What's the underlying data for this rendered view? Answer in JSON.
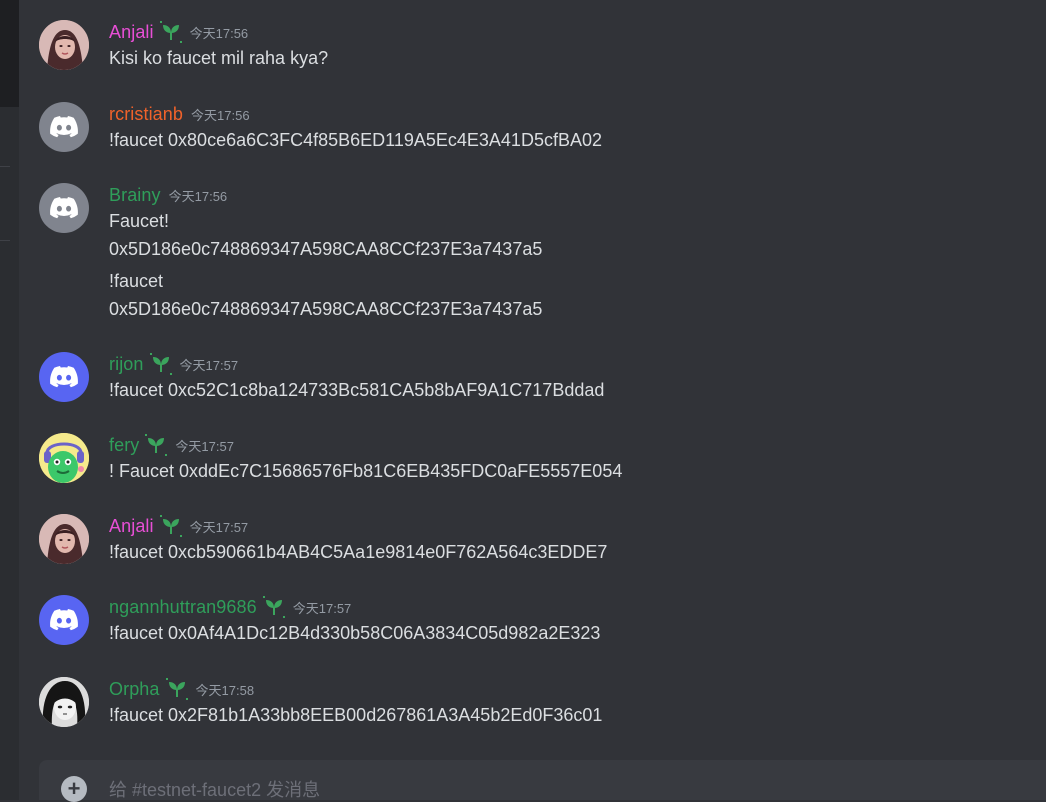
{
  "colors": {
    "bg": "#313338",
    "text": "#dbdee1",
    "timestamp": "#949ba4",
    "pink_name": "#e84fd6",
    "orange_name": "#f0622a",
    "green_name": "#2f9e5a",
    "discord_grey": "#80848e",
    "discord_blurple": "#5865f2",
    "badge_green": "#3ba55d"
  },
  "messages": [
    {
      "username": "Anjali",
      "time": "今天17:56",
      "lines": [
        "Kisi ko faucet mil raha kya?"
      ]
    },
    {
      "username": "rcristianb",
      "time": "今天17:56",
      "lines": [
        "!faucet 0x80ce6a6C3FC4f85B6ED119A5Ec4E3A41D5cfBA02"
      ]
    },
    {
      "username": "Brainy",
      "time": "今天17:56",
      "lines": [
        "Faucet!",
        "0x5D186e0c748869347A598CAA8CCf237E3a7437a5",
        "!faucet",
        "0x5D186e0c748869347A598CAA8CCf237E3a7437a5"
      ]
    },
    {
      "username": "rijon",
      "time": "今天17:57",
      "lines": [
        "!faucet 0xc52C1c8ba124733Bc581CA5b8bAF9A1C717Bddad"
      ]
    },
    {
      "username": "fery",
      "time": "今天17:57",
      "lines": [
        "! Faucet 0xddEc7C15686576Fb81C6EB435FDC0aFE5557E054"
      ]
    },
    {
      "username": "Anjali",
      "time": "今天17:57",
      "lines": [
        "!faucet 0xcb590661b4AB4C5Aa1e9814e0F762A564c3EDDE7"
      ]
    },
    {
      "username": "ngannhuttran9686",
      "time": "今天17:57",
      "lines": [
        "!faucet 0x0Af4A1Dc12B4d330b58C06A3834C05d982a2E323"
      ]
    },
    {
      "username": "Orpha",
      "time": "今天17:58",
      "lines": [
        "!faucet 0x2F81b1A33bb8EEB00d267861A3A45b2Ed0F36c01"
      ]
    }
  ],
  "composer": {
    "placeholder": "给 #testnet-faucet2 发消息",
    "add_icon": "plus-circle-icon"
  }
}
